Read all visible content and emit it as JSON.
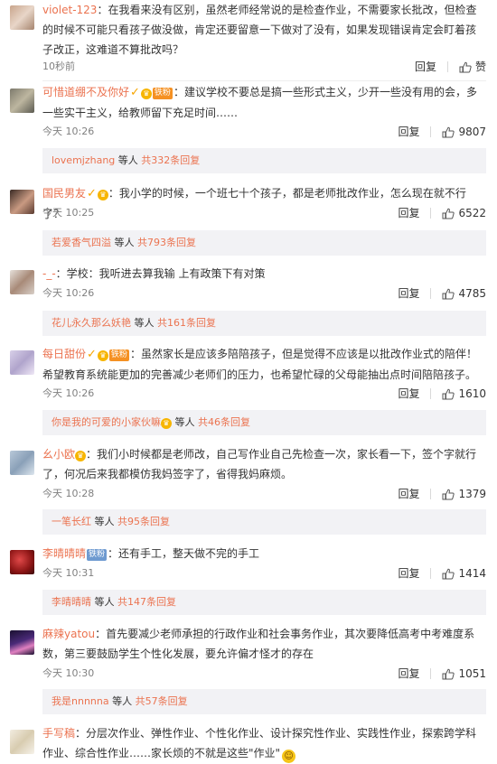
{
  "comments": [
    {
      "user": "violet-123",
      "text": "：在我看来没有区别，虽然老师经常说的是检查作业，不需要家长批改，但检查的时候不可能只看孩子做没做，肯定还要留意一下做对了没有，如果发现错误肯定会盯着孩子改正，这难道不算批改吗？",
      "time": "10秒前",
      "reply": "回复",
      "likes": "赞"
    },
    {
      "user": "可惜道绷不及你好",
      "badge": "铁粉",
      "text": "：建议学校不要总是搞一些形式主义，少开一些没有用的会，多一些实干主义，给教师留下充足时间……",
      "time": "今天 10:26",
      "reply": "回复",
      "likes": "9807",
      "sub_name": "lovemjzhang",
      "sub_text": " 等人 ",
      "sub_count": "共332条回复"
    },
    {
      "user": "国民男友",
      "text": "：我小学的时候，一个班七十个孩子，都是老师批改作业，怎么现在就不行了？",
      "time": "今天 10:25",
      "reply": "回复",
      "likes": "6522",
      "sub_name": "若爱香气四溢",
      "sub_text": " 等人 ",
      "sub_count": "共793条回复"
    },
    {
      "user": "-_-",
      "text": "：学校：我听进去算我输 上有政策下有对策",
      "time": "今天 10:26",
      "reply": "回复",
      "likes": "4785",
      "sub_name": "花儿永久那么妖艳",
      "sub_text": " 等人 ",
      "sub_count": "共161条回复"
    },
    {
      "user": "每日甜份",
      "badge": "铁粉",
      "text": "：虽然家长是应该多陪陪孩子，但是觉得不应该是以批改作业式的陪伴！希望教育系统能更加的完善减少老师们的压力，也希望忙碌的父母能抽出点时间陪陪孩子。",
      "time": "今天 10:26",
      "reply": "回复",
      "likes": "1610",
      "sub_name": "你是我的可爱的小家伙嘛",
      "sub_text": " 等人 ",
      "sub_count": "共46条回复"
    },
    {
      "user": "幺小欧",
      "text": "：我们小时候都是老师改，自己写作业自己先检查一次，家长看一下，签个字就行了，何况后来我都模仿我妈签字了，省得我妈麻烦。",
      "time": "今天 10:28",
      "reply": "回复",
      "likes": "1379",
      "sub_name": "一笔长红",
      "sub_text": " 等人 ",
      "sub_count": "共95条回复"
    },
    {
      "user": "李晴晴晴",
      "badge": "铁粉",
      "text": "：还有手工，整天做不完的手工",
      "time": "今天 10:31",
      "reply": "回复",
      "likes": "1414",
      "sub_name": "李晴晴晴",
      "sub_text": " 等人 ",
      "sub_count": "共147条回复"
    },
    {
      "user": "麻辣yatou",
      "text": "：首先要减少老师承担的行政作业和社会事务作业，其次要降低高考中考难度系数，第三要鼓励学生个性化发展，要允许偏才怪才的存在",
      "time": "今天 10:30",
      "reply": "回复",
      "likes": "1051",
      "sub_name": "我是nnnnna",
      "sub_text": " 等人 ",
      "sub_count": "共57条回复"
    },
    {
      "user": "手写稿",
      "text": "：分层次作业、弹性作业、个性化作业、设计探究性作业、实践性作业，探索跨学科作业、综合性作业……家长烦的不就是这些\"作业\"",
      "emoji": "☺"
    }
  ],
  "colors": {
    "name": "#eb7350",
    "muted": "#808080",
    "subbg": "#f2f2f5",
    "vip": "#f7b500",
    "fan": "#f59123"
  }
}
